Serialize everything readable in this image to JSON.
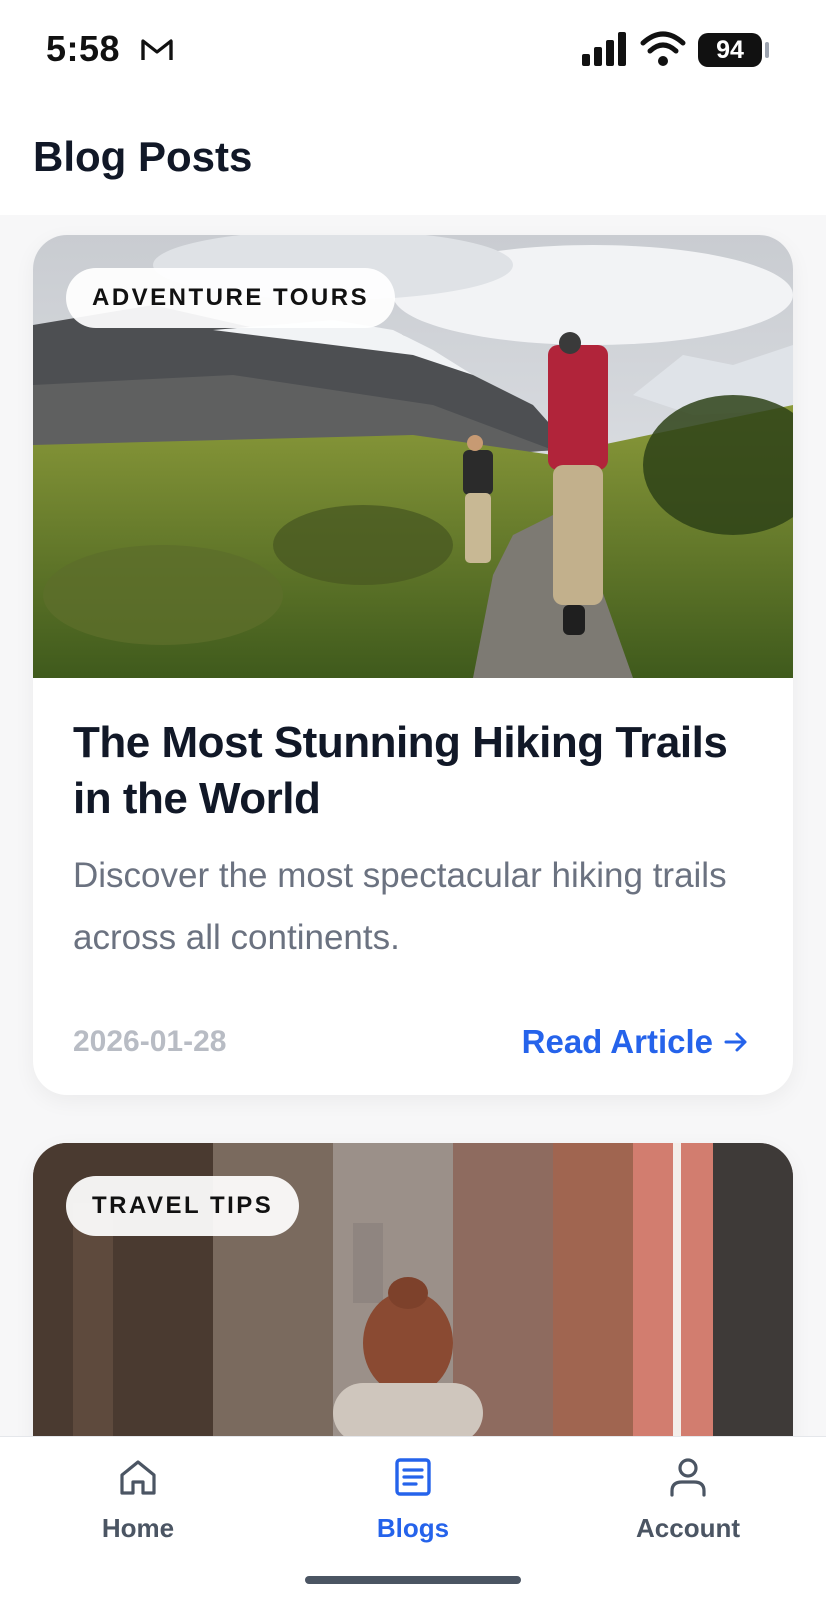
{
  "status_bar": {
    "time": "5:58",
    "battery": "94",
    "icons": [
      "gmail-icon",
      "signal-icon",
      "wifi-icon",
      "battery-icon"
    ]
  },
  "header": {
    "title": "Blog Posts"
  },
  "posts": [
    {
      "category": "ADVENTURE TOURS",
      "title": "The Most Stunning Hiking Trails in the World",
      "excerpt": "Discover the most spectacular hiking trails across all continents.",
      "date": "2026-01-28",
      "cta": "Read Article",
      "image": "hikers-mountain-trail-photo"
    },
    {
      "category": "TRAVEL TIPS",
      "image": "woman-narrow-street-photo"
    }
  ],
  "bottom_nav": {
    "items": [
      {
        "label": "Home",
        "icon": "home-icon",
        "active": false
      },
      {
        "label": "Blogs",
        "icon": "article-icon",
        "active": true
      },
      {
        "label": "Account",
        "icon": "person-icon",
        "active": false
      }
    ],
    "active_color": "#2563eb",
    "inactive_color": "#4b5563"
  },
  "colors": {
    "accent": "#2563eb",
    "title": "#111827",
    "muted": "#6b7280",
    "date": "#b8bcc4"
  }
}
